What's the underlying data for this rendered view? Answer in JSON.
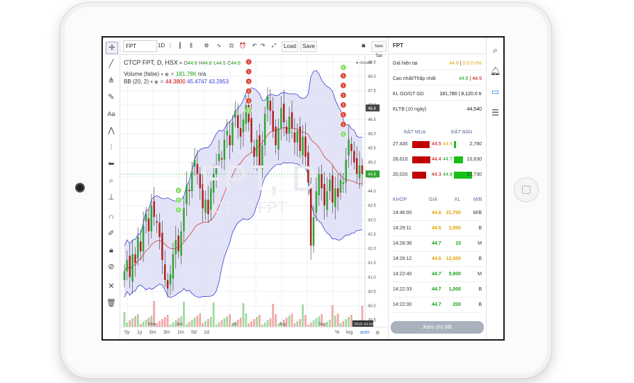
{
  "toolbar": {
    "symbol": "FPT",
    "interval": "1D",
    "load_label": "Load",
    "save_label": "Save",
    "new_tab_label": "New Tab"
  },
  "chart_header": {
    "title": "CTCP FPT, D, HSX",
    "ohlc": {
      "O": "44.6",
      "H": "44.8",
      "L": "44.5",
      "C": "44.6"
    },
    "volume_label": "Volume (false)",
    "volume_value": "181.78K",
    "volume_na": "n/a",
    "bb_label": "BB (20, 2)",
    "bb_values": [
      "44.3800",
      "45.4747",
      "43.2853"
    ],
    "status": "closed",
    "watermark_symbol": "FPT, D",
    "watermark_name": "CTCP FPT"
  },
  "y_axis": {
    "ticks": [
      "48.5",
      "48.0",
      "47.5",
      "47.0",
      "46.5",
      "46.0",
      "45.5",
      "45.0",
      "44.5",
      "44.0",
      "43.5",
      "43.0",
      "42.5",
      "42.0",
      "41.5",
      "41.0",
      "40.5",
      "40.0",
      "39.5"
    ],
    "last_price": "44.6",
    "marker_price": "46.9"
  },
  "x_axis": {
    "labels": [
      "May",
      "Jun",
      "Jul",
      "Aug",
      "Sep"
    ],
    "current_date": "2015-10-02"
  },
  "ranges": [
    "5y",
    "1y",
    "6m",
    "3m",
    "1m",
    "5d",
    "1d"
  ],
  "bottom_options": [
    "%",
    "log",
    "auto"
  ],
  "markers": {
    "buy_letter": "B",
    "sell_letter": "S"
  },
  "chart_data": {
    "type": "candlestick",
    "ylim": [
      39.25,
      48.75
    ],
    "series_close": [
      41.2,
      41.6,
      41.0,
      41.8,
      41.5,
      42.4,
      41.9,
      42.8,
      43.2,
      42.6,
      43.5,
      43.1,
      42.9,
      42.4,
      41.6,
      40.9,
      40.6,
      41.1,
      41.8,
      42.3,
      41.9,
      42.6,
      43.4,
      44.2,
      44.0,
      44.7,
      45.1,
      44.6,
      44.1,
      43.4,
      43.7,
      43.2,
      44.1,
      44.6,
      44.9,
      45.3,
      45.1,
      45.8,
      46.1,
      45.6,
      46.4,
      46.8,
      46.2,
      45.9,
      46.5,
      47.0,
      46.4,
      45.7,
      45.2,
      45.8,
      44.9,
      45.6,
      46.7,
      47.3,
      46.8,
      46.1,
      45.6,
      46.2,
      46.9,
      46.4,
      46.0,
      46.6,
      46.2,
      45.7,
      46.1,
      45.4,
      45.9,
      45.2,
      44.3,
      42.1,
      43.1,
      44.0,
      44.6,
      44.1,
      43.5,
      44.0,
      44.4,
      43.6,
      44.1,
      43.8,
      44.4,
      44.3,
      45.1,
      45.8,
      45.4,
      45.0,
      44.6,
      44.9,
      44.6
    ],
    "bb_middle_desc": "moving average rising from 40.5 to 46.3 then easing to 44.4",
    "volume_note": "volume bars at bottom"
  },
  "panel": {
    "symbol": "FPT",
    "rows": [
      {
        "label": "Giá hiện tại",
        "value": "44.6",
        "extra": "0.0 0.0%"
      },
      {
        "label": "Cao nhất/Thấp nhất",
        "value": "44.8",
        "extra": "44.5"
      },
      {
        "label": "KL GD/GT GD",
        "value": "181,780",
        "extra": "8,120.0 tr"
      },
      {
        "label": "KLTB (10 ngày)",
        "value": "44,540",
        "extra": ""
      }
    ],
    "orderbook_headers": {
      "buy": "ĐẶT MUA",
      "sell": "ĐẶT BÁN"
    },
    "orderbook": [
      {
        "buy_vol": "27,430",
        "buy_price": "44.5",
        "sell_price": "44.6",
        "sell_vol": "2,780",
        "buy_frac": 0.58,
        "sell_frac": 0.08
      },
      {
        "buy_vol": "28,610",
        "buy_price": "44.4",
        "sell_price": "44.7",
        "sell_vol": "10,630",
        "buy_frac": 0.6,
        "sell_frac": 0.3
      },
      {
        "buy_vol": "20,020",
        "buy_price": "44.3",
        "sell_price": "44.8",
        "sell_vol": "21,730",
        "buy_frac": 0.45,
        "sell_frac": 0.62
      }
    ],
    "trade_headers": {
      "time": "KHỚP",
      "price": "GIÁ",
      "vol": "KL",
      "side": "M/B"
    },
    "trades": [
      {
        "time": "14:46:05",
        "price": "44.6",
        "vol": "21,700",
        "side": "M/B",
        "color": "yellow"
      },
      {
        "time": "14:29:11",
        "price": "44.6",
        "vol": "2,000",
        "side": "B",
        "color": "yellow"
      },
      {
        "time": "14:28:36",
        "price": "44.7",
        "vol": "10",
        "side": "M",
        "color": "green"
      },
      {
        "time": "14:26:12",
        "price": "44.6",
        "vol": "12,000",
        "side": "B",
        "color": "yellow"
      },
      {
        "time": "14:22:40",
        "price": "44.7",
        "vol": "5,900",
        "side": "M",
        "color": "green"
      },
      {
        "time": "14:22:33",
        "price": "44.7",
        "vol": "1,000",
        "side": "B",
        "color": "green"
      },
      {
        "time": "14:22:00",
        "price": "44.7",
        "vol": "200",
        "side": "B",
        "color": "green"
      }
    ],
    "detail_label": "Xem chi tiết"
  },
  "colors": {
    "up": "#2ea52e",
    "down": "#b02020",
    "bb_band": "#3a3ad8",
    "bb_fill": "#dfe0f5",
    "ma": "#d23b3b"
  }
}
